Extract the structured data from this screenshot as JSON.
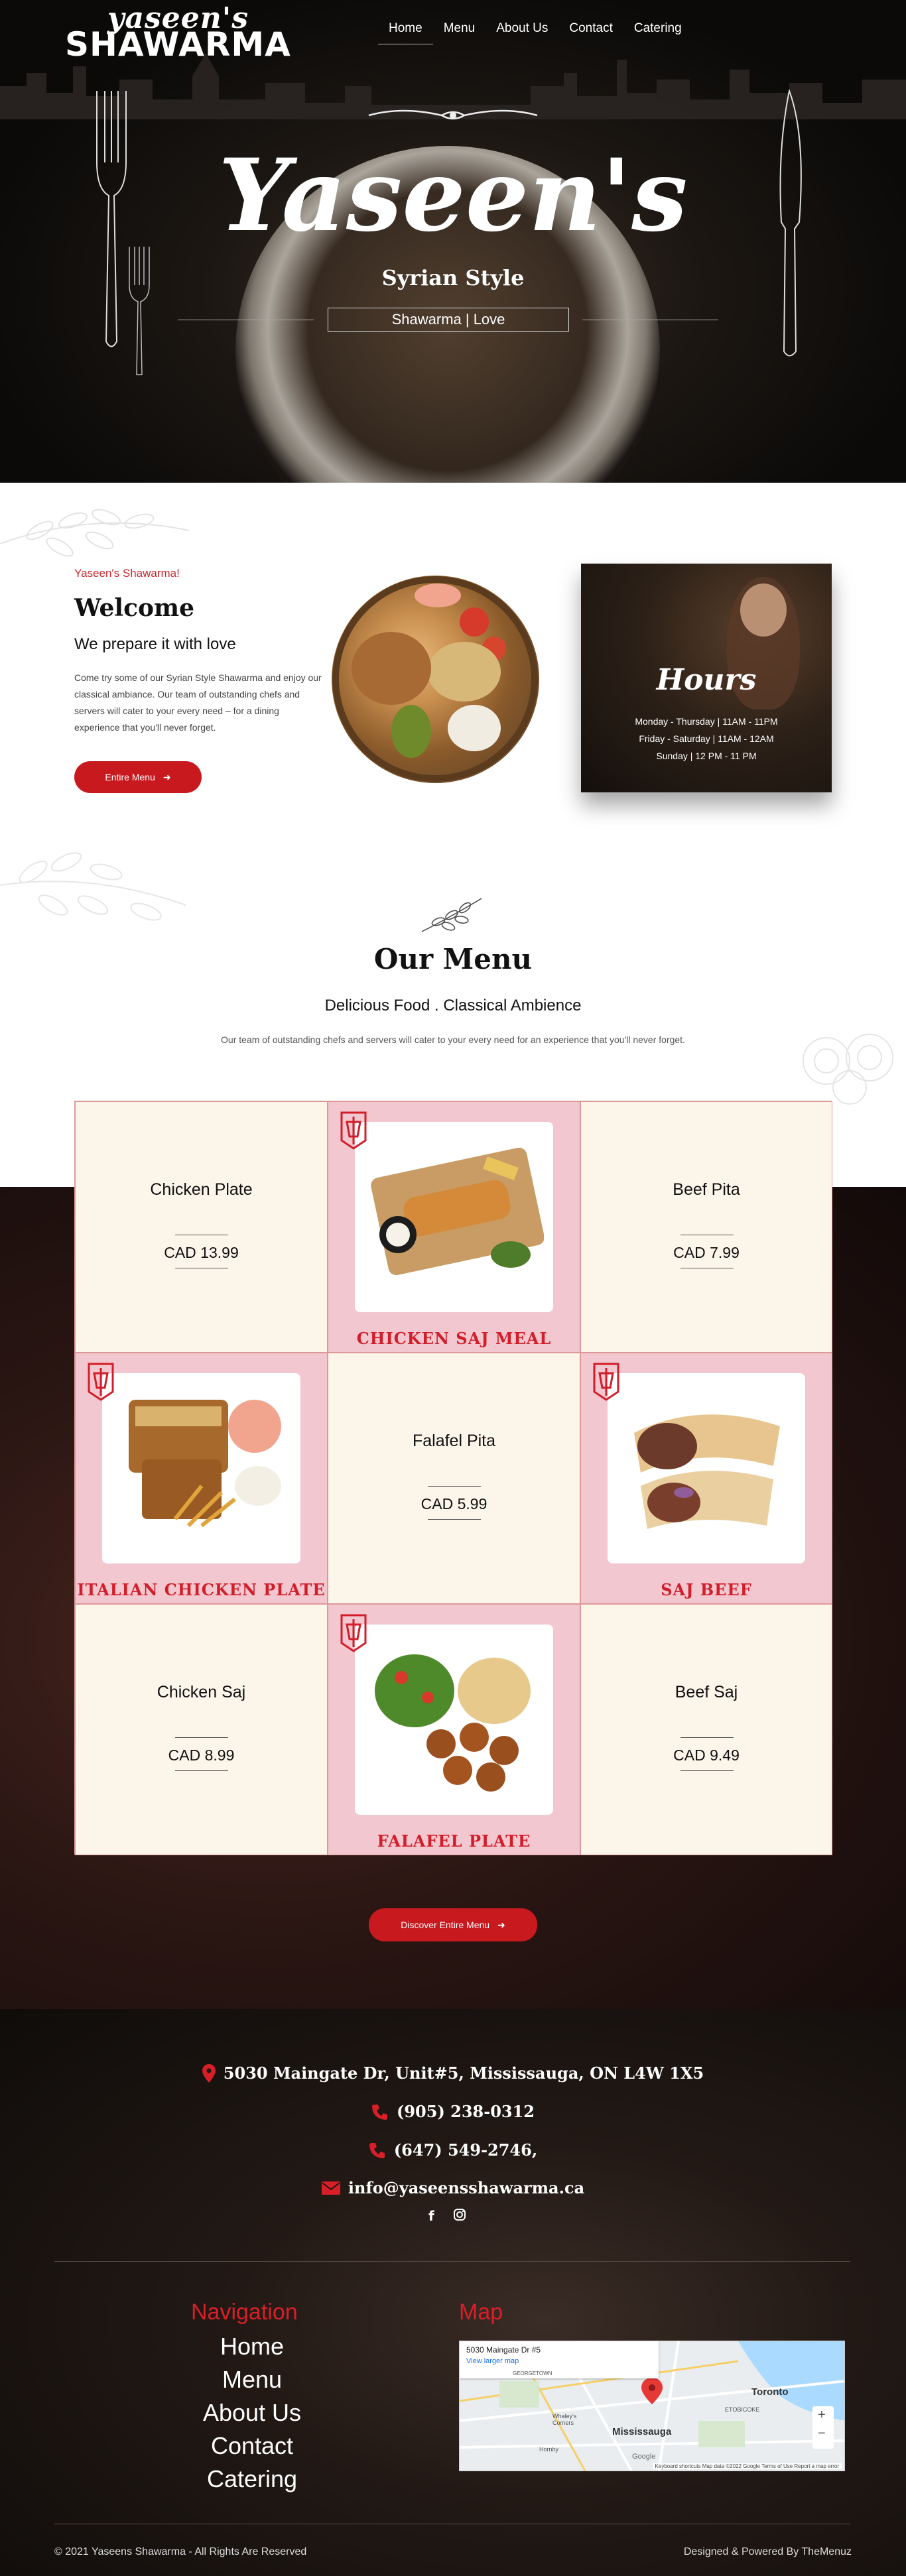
{
  "brand": {
    "line1": "yaseen's",
    "line2": "SHAWARMA"
  },
  "nav": [
    {
      "label": "Home",
      "active": true
    },
    {
      "label": "Menu"
    },
    {
      "label": "About Us"
    },
    {
      "label": "Contact"
    },
    {
      "label": "Catering"
    }
  ],
  "hero": {
    "title": "Yaseen's",
    "subtitle": "Syrian Style",
    "tagline": "Shawarma | Love"
  },
  "welcome": {
    "eyebrow": "Yaseen's Shawarma!",
    "title": "Welcome",
    "subtitle": "We prepare it with love",
    "body": "Come try some of our Syrian Style Shawarma and enjoy our classical ambiance. Our team of outstanding chefs and servers will cater to your every need – for a dining experience that you'll never forget.",
    "button": "Entire Menu"
  },
  "hours": {
    "title": "Hours",
    "lines": [
      "Monday - Thursday | 11AM - 11PM",
      "Friday - Saturday | 11AM - 12AM",
      "Sunday | 12 PM - 11 PM"
    ]
  },
  "menu": {
    "title": "Our Menu",
    "subtitle": "Delicious Food . Classical Ambience",
    "body": "Our team of outstanding chefs and servers will cater to your every need for an experience that you'll never forget.",
    "items": [
      {
        "type": "text",
        "name": "Chicken Plate",
        "price": "CAD 13.99"
      },
      {
        "type": "image",
        "caption": "CHICKEN SAJ MEAL"
      },
      {
        "type": "text",
        "name": "Beef Pita",
        "price": "CAD 7.99"
      },
      {
        "type": "image",
        "caption": "ITALIAN CHICKEN PLATE"
      },
      {
        "type": "text",
        "name": "Falafel Pita",
        "price": "CAD 5.99"
      },
      {
        "type": "image",
        "caption": "SAJ BEEF"
      },
      {
        "type": "text",
        "name": "Chicken Saj",
        "price": "CAD 8.99"
      },
      {
        "type": "image",
        "caption": "FALAFEL PLATE"
      },
      {
        "type": "text",
        "name": "Beef Saj",
        "price": "CAD 9.49"
      }
    ],
    "button": "Discover Entire Menu"
  },
  "contact": {
    "address": "5030 Maingate Dr, Unit#5, Mississauga, ON L4W 1X5",
    "phone1": "(905) 238-0312",
    "phone2": "(647) 549-2746,",
    "email": "info@yaseensshawarma.ca"
  },
  "footer": {
    "nav_heading": "Navigation",
    "map_heading": "Map",
    "links": [
      "Home",
      "Menu",
      "About Us",
      "Contact",
      "Catering"
    ],
    "map": {
      "address": "5030 Maingate Dr #5",
      "link": "View larger map",
      "city": "Mississauga",
      "city2": "Toronto",
      "area1": "ETOBICOKE",
      "area2": "Whaley's Corners",
      "area3": "Hornby",
      "area4": "GEORGETOWN",
      "credits": "Keyboard shortcuts   Map data ©2022 Google   Terms of Use   Report a map error",
      "google": "Google"
    },
    "copyright": "© 2021 Yaseens Shawarma - All Rights Are Reserved",
    "powered": "Designed & Powered By TheMenuz"
  },
  "colors": {
    "accent": "#c8191f",
    "cream": "#fbf5ea",
    "pink": "#f3c7cf"
  }
}
